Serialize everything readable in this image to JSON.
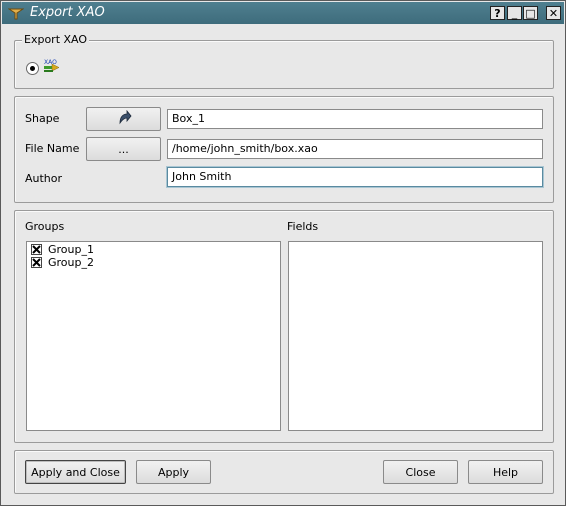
{
  "window": {
    "title": "Export XAO",
    "title_buttons": [
      "?",
      "_",
      "□",
      "✕"
    ]
  },
  "export_group": {
    "title": "Export XAO",
    "radio_selected": true,
    "icon": "xao-export-icon"
  },
  "form": {
    "shape_label": "Shape",
    "shape_button_icon": "select-arrow-icon",
    "shape_value": "Box_1",
    "filename_label": "File Name",
    "filename_button": "...",
    "filename_value": "/home/john_smith/box.xao",
    "author_label": "Author",
    "author_value": "John Smith"
  },
  "groups": {
    "title": "Groups",
    "items": [
      {
        "label": "Group_1",
        "checked": true
      },
      {
        "label": "Group_2",
        "checked": true
      }
    ]
  },
  "fields": {
    "title": "Fields",
    "items": []
  },
  "buttons": {
    "apply_and_close": "Apply and Close",
    "apply": "Apply",
    "close": "Close",
    "help": "Help"
  }
}
